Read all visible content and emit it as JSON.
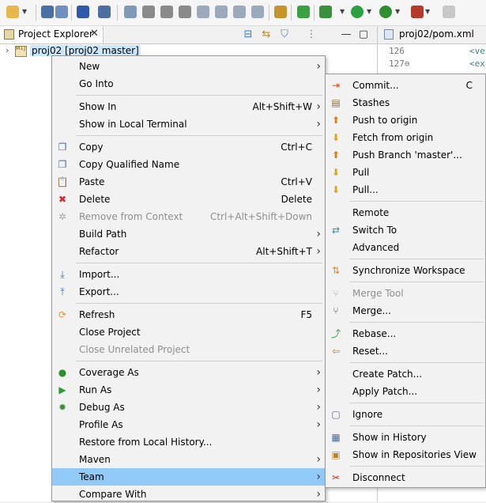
{
  "toolbar": {
    "icons": [
      "new-icon",
      "save-icon",
      "save-all-icon",
      "terminal-icon",
      "skip-breakpoints-icon",
      "resume-icon",
      "suspend-icon",
      "terminate-icon",
      "disconnect-icon",
      "step-into-icon",
      "step-over-icon",
      "step-return-icon",
      "use-step-filters-icon",
      "toggle-ant-icon",
      "spring-icon",
      "debug-icon",
      "run-icon",
      "coverage-icon",
      "external-tools-icon",
      "stop-icon"
    ]
  },
  "project_explorer": {
    "tab_label": "Project Explorer",
    "close": "✕",
    "tree": {
      "project_label": "proj02 [proj02 master]",
      "icon_text": "M↓J"
    }
  },
  "editor": {
    "tab_label": "proj02/pom.xml",
    "close": "✕",
    "lines": [
      {
        "num": "126",
        "code": "<ve"
      },
      {
        "num": "127⊖",
        "code": "<ex"
      }
    ]
  },
  "context_menu": {
    "items": [
      {
        "label": "New",
        "submenu": true,
        "icon": ""
      },
      {
        "label": "Go Into",
        "icon": ""
      },
      {
        "sep": true
      },
      {
        "label": "Show In",
        "accel": "Alt+Shift+W",
        "submenu": true,
        "icon": ""
      },
      {
        "label": "Show in Local Terminal",
        "submenu": true,
        "icon": ""
      },
      {
        "sep": true
      },
      {
        "label": "Copy",
        "accel": "Ctrl+C",
        "icon": "copy-icon"
      },
      {
        "label": "Copy Qualified Name",
        "icon": "copy-qualified-icon"
      },
      {
        "label": "Paste",
        "accel": "Ctrl+V",
        "icon": "paste-icon"
      },
      {
        "label": "Delete",
        "accel": "Delete",
        "icon": "delete-icon"
      },
      {
        "label": "Remove from Context",
        "accel": "Ctrl+Alt+Shift+Down",
        "disabled": true,
        "icon": "remove-context-icon"
      },
      {
        "label": "Build Path",
        "submenu": true,
        "icon": ""
      },
      {
        "label": "Refactor",
        "accel": "Alt+Shift+T",
        "submenu": true,
        "icon": ""
      },
      {
        "sep": true
      },
      {
        "label": "Import...",
        "icon": "import-icon"
      },
      {
        "label": "Export...",
        "icon": "export-icon"
      },
      {
        "sep": true
      },
      {
        "label": "Refresh",
        "accel": "F5",
        "icon": "refresh-icon"
      },
      {
        "label": "Close Project",
        "icon": ""
      },
      {
        "label": "Close Unrelated Project",
        "disabled": true,
        "icon": ""
      },
      {
        "sep": true
      },
      {
        "label": "Coverage As",
        "submenu": true,
        "icon": "coverage-icon"
      },
      {
        "label": "Run As",
        "submenu": true,
        "icon": "run-icon"
      },
      {
        "label": "Debug As",
        "submenu": true,
        "icon": "debug-icon"
      },
      {
        "label": "Profile As",
        "submenu": true,
        "icon": ""
      },
      {
        "label": "Restore from Local History...",
        "icon": ""
      },
      {
        "label": "Maven",
        "submenu": true,
        "icon": ""
      },
      {
        "label": "Team",
        "submenu": true,
        "highlighted": true,
        "icon": ""
      },
      {
        "label": "Compare With",
        "submenu": true,
        "icon": ""
      }
    ]
  },
  "team_menu": {
    "items": [
      {
        "label": "Commit...",
        "accel": "C",
        "icon": "commit-icon"
      },
      {
        "label": "Stashes",
        "icon": "stashes-icon"
      },
      {
        "label": "Push to origin",
        "icon": "push-icon"
      },
      {
        "label": "Fetch from origin",
        "icon": "fetch-icon"
      },
      {
        "label": "Push Branch 'master'...",
        "icon": "push-branch-icon"
      },
      {
        "label": "Pull",
        "icon": "pull-icon"
      },
      {
        "label": "Pull...",
        "icon": "pull-dialog-icon"
      },
      {
        "sep": true
      },
      {
        "label": "Remote",
        "icon": ""
      },
      {
        "label": "Switch To",
        "icon": "switch-icon"
      },
      {
        "label": "Advanced",
        "icon": ""
      },
      {
        "sep": true
      },
      {
        "label": "Synchronize Workspace",
        "icon": "synchronize-icon"
      },
      {
        "sep": true
      },
      {
        "label": "Merge Tool",
        "disabled": true,
        "icon": "merge-tool-icon"
      },
      {
        "label": "Merge...",
        "icon": "merge-icon"
      },
      {
        "sep": true
      },
      {
        "label": "Rebase...",
        "icon": "rebase-icon"
      },
      {
        "label": "Reset...",
        "icon": "reset-icon"
      },
      {
        "sep": true
      },
      {
        "label": "Create Patch...",
        "icon": ""
      },
      {
        "label": "Apply Patch...",
        "icon": ""
      },
      {
        "sep": true
      },
      {
        "label": "Ignore",
        "icon": "ignore-icon"
      },
      {
        "sep": true
      },
      {
        "label": "Show in History",
        "icon": "history-icon"
      },
      {
        "label": "Show in Repositories View",
        "icon": "repositories-icon"
      },
      {
        "sep": true
      },
      {
        "label": "Disconnect",
        "icon": "disconnect-icon"
      }
    ]
  },
  "icon_styles": {
    "copy-icon": {
      "glyph": "❐",
      "color": "#3b6ea5"
    },
    "copy-qualified-icon": {
      "glyph": "❐",
      "color": "#3b6ea5"
    },
    "paste-icon": {
      "glyph": "📋",
      "color": "#9c7a2c"
    },
    "delete-icon": {
      "glyph": "✖",
      "color": "#d8262c"
    },
    "remove-context-icon": {
      "glyph": "✲",
      "color": "#a8a8a8"
    },
    "import-icon": {
      "glyph": "⤓",
      "color": "#3a6fb0"
    },
    "export-icon": {
      "glyph": "⤒",
      "color": "#3a6fb0"
    },
    "refresh-icon": {
      "glyph": "⟳",
      "color": "#d6982a"
    },
    "coverage-icon": {
      "glyph": "●",
      "color": "#2f8f2f"
    },
    "run-icon": {
      "glyph": "▶",
      "color": "#2a9a3a"
    },
    "debug-icon": {
      "glyph": "✹",
      "color": "#3c8f3c"
    },
    "commit-icon": {
      "glyph": "⇥",
      "color": "#d94b1f"
    },
    "stashes-icon": {
      "glyph": "▤",
      "color": "#8a6d3b"
    },
    "push-icon": {
      "glyph": "⬆",
      "color": "#e07a10"
    },
    "fetch-icon": {
      "glyph": "⬇",
      "color": "#e0a010"
    },
    "push-branch-icon": {
      "glyph": "⬆",
      "color": "#e07a10"
    },
    "pull-icon": {
      "glyph": "⬇",
      "color": "#d9a21b"
    },
    "pull-dialog-icon": {
      "glyph": "⬇",
      "color": "#d9a21b"
    },
    "switch-icon": {
      "glyph": "⇄",
      "color": "#3a8aa8"
    },
    "synchronize-icon": {
      "glyph": "⇅",
      "color": "#d8882a"
    },
    "merge-tool-icon": {
      "glyph": "⑂",
      "color": "#a8a8a8"
    },
    "merge-icon": {
      "glyph": "⑂",
      "color": "#5c5c5c"
    },
    "rebase-icon": {
      "glyph": "⤴",
      "color": "#3c9a3c"
    },
    "reset-icon": {
      "glyph": "⇦",
      "color": "#c27a2a"
    },
    "ignore-icon": {
      "glyph": "▢",
      "color": "#5d6c8a"
    },
    "history-icon": {
      "glyph": "▦",
      "color": "#4a6a9a"
    },
    "repositories-icon": {
      "glyph": "▣",
      "color": "#b8862a"
    },
    "disconnect-icon": {
      "glyph": "✂",
      "color": "#c8302c"
    }
  },
  "colors": {
    "highlight": "#91c9f7",
    "menu_bg": "#f2f2f2",
    "disabled_text": "#8f8f8f",
    "tree_selection": "#cce8ff"
  }
}
